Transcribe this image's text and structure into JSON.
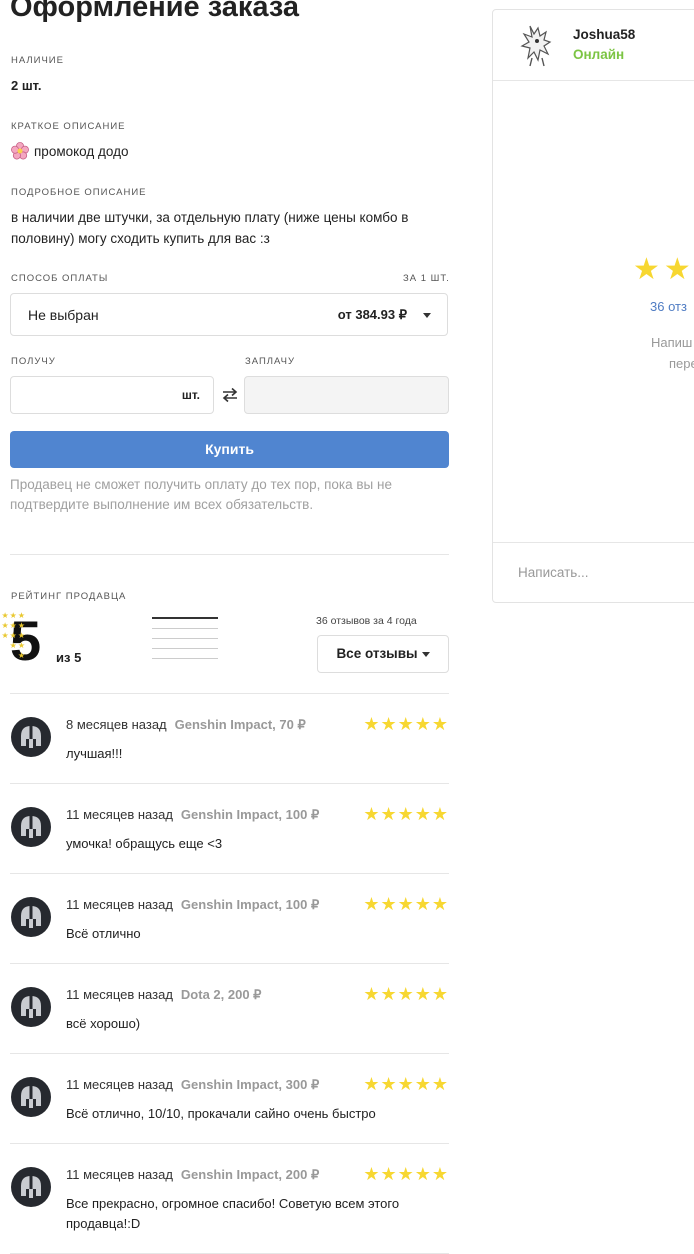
{
  "page_title": "Оформление заказа",
  "availability": {
    "label": "Наличие",
    "value": "2 шт."
  },
  "short_desc": {
    "label": "Краткое описание",
    "icon": "flower-icon",
    "value": "промокод додо"
  },
  "long_desc": {
    "label": "Подробное описание",
    "value": "в наличии две штучки, за отдельную плату (ниже цены комбо в половину) могу сходить купить для вас :з"
  },
  "payment": {
    "label": "Способ оплаты",
    "per_unit": "за 1 шт.",
    "selected": "Не выбран",
    "price": "от 384.93 ₽"
  },
  "receive": {
    "label": "Получу",
    "unit": "шт."
  },
  "pay": {
    "label": "Заплачу"
  },
  "buy_button": "Купить",
  "note": "Продавец не сможет получить оплату до тех пор, пока вы не подтвердите выполнение им всех обязательств.",
  "rating": {
    "label": "Рейтинг продавца",
    "score": "5",
    "out_of": "из 5",
    "distribution": [
      {
        "stars": "★★★★★",
        "fraction": 1.0
      },
      {
        "stars": "★★★★",
        "fraction": 0.0
      },
      {
        "stars": "★★★",
        "fraction": 0.0
      },
      {
        "stars": "★★",
        "fraction": 0.0
      },
      {
        "stars": "★",
        "fraction": 0.0
      }
    ],
    "reviews_count": "36 отзывов за 4 года",
    "all_reviews_button": "Все отзывы"
  },
  "reviews": [
    {
      "when": "8 месяцев назад",
      "game": "Genshin Impact, 70 ₽",
      "stars": "★★★★★",
      "text": "лучшая!!!"
    },
    {
      "when": "11 месяцев назад",
      "game": "Genshin Impact, 100 ₽",
      "stars": "★★★★★",
      "text": "умочка! обращусь еще <3"
    },
    {
      "when": "11 месяцев назад",
      "game": "Genshin Impact, 100 ₽",
      "stars": "★★★★★",
      "text": "Всё отлично"
    },
    {
      "when": "11 месяцев назад",
      "game": "Dota 2, 200 ₽",
      "stars": "★★★★★",
      "text": "всё хорошо)"
    },
    {
      "when": "11 месяцев назад",
      "game": "Genshin Impact, 300 ₽",
      "stars": "★★★★★",
      "text": "Всё отлично, 10/10, прокачали сайно очень быстро"
    },
    {
      "when": "11 месяцев назад",
      "game": "Genshin Impact, 200 ₽",
      "stars": "★★★★★",
      "text": "Все прекрасно, огромное спасибо! Советую всем этого продавца!:D"
    }
  ],
  "seller": {
    "name": "Joshua58",
    "status": "Онлайн",
    "stars": "★★",
    "reviews_link": "36 отз",
    "hint_line1": "Напиш",
    "hint_line2": "пере",
    "message_placeholder": "Написать..."
  },
  "colors": {
    "accent": "#5085d0",
    "star": "#f7d731",
    "online": "#7bc443",
    "link": "#4f7cc3"
  }
}
